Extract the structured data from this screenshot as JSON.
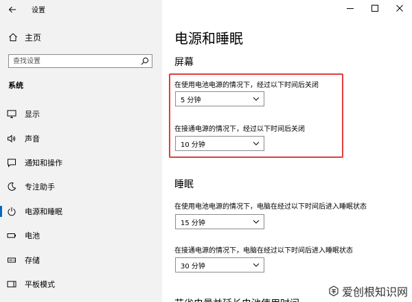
{
  "window": {
    "title": "设置"
  },
  "sidebar": {
    "home_label": "主页",
    "search_placeholder": "查找设置",
    "section_label": "系统",
    "items": [
      {
        "label": "显示",
        "icon": "monitor-icon"
      },
      {
        "label": "声音",
        "icon": "speaker-icon"
      },
      {
        "label": "通知和操作",
        "icon": "notification-icon"
      },
      {
        "label": "专注助手",
        "icon": "moon-icon"
      },
      {
        "label": "电源和睡眠",
        "icon": "power-icon",
        "active": true
      },
      {
        "label": "电池",
        "icon": "battery-icon"
      },
      {
        "label": "存储",
        "icon": "storage-icon"
      },
      {
        "label": "平板模式",
        "icon": "tablet-icon"
      }
    ]
  },
  "main": {
    "page_title": "电源和睡眠",
    "screen": {
      "title": "屏幕",
      "battery_label": "在使用电池电源的情况下，经过以下时间后关闭",
      "battery_value": "5 分钟",
      "plugged_label": "在接通电源的情况下，经过以下时间后关闭",
      "plugged_value": "10 分钟"
    },
    "sleep": {
      "title": "睡眠",
      "battery_label": "在使用电池电源的情况下，电脑在经过以下时间后进入睡眠状态",
      "battery_value": "15 分钟",
      "plugged_label": "在接通电源的情况下，电脑在经过以下时间后进入睡眠状态",
      "plugged_value": "30 分钟"
    },
    "next_heading": "节省电量并延长电池使用时间"
  },
  "watermark": {
    "text": "爱创根知识网"
  },
  "colors": {
    "accent": "#0067c0",
    "highlight": "#e13c3c",
    "sidebar_bg": "#f2f2f2"
  }
}
